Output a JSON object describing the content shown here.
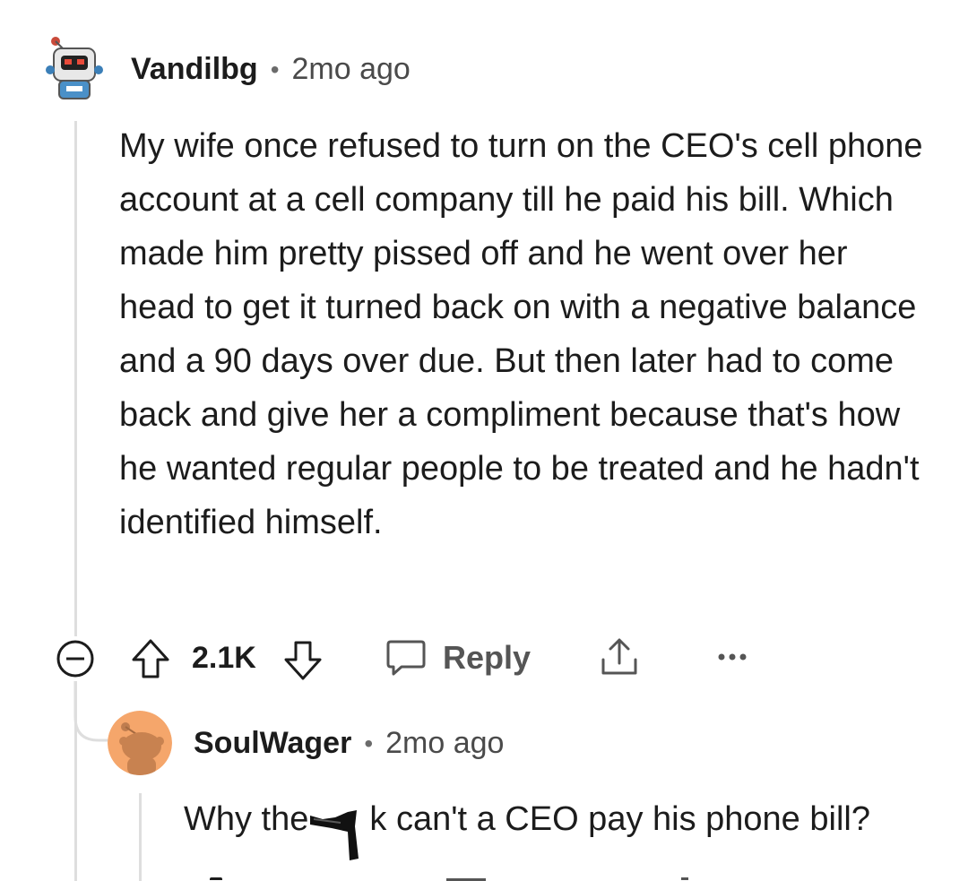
{
  "comment": {
    "author": "Vandilbg",
    "time": "2mo ago",
    "separator": "•",
    "body": "My wife once refused to turn on the CEO's cell phone account at a cell company till he paid his bill. Which made him pretty pissed off and he went over her head to get it turned back on with a negative balance and a 90 days over due. But then later had to come back and give her a compliment because that's how he wanted regular people to be treated and he hadn't identified himself.",
    "vote_count": "2.1K",
    "reply_label": "Reply"
  },
  "reply": {
    "author": "SoulWager",
    "time": "2mo ago",
    "separator": "•",
    "body_before": "Why the",
    "body_after": "k can't a CEO pay his phone bill?"
  },
  "icons": {
    "collapse": "collapse-minus-icon",
    "upvote": "arrow-up-icon",
    "downvote": "arrow-down-icon",
    "reply": "speech-bubble-icon",
    "share": "share-icon",
    "more": "more-dots-icon",
    "censor": "censor-sticker"
  },
  "colors": {
    "text": "#1c1c1c",
    "muted": "#4a4a4a",
    "thread_line": "#dedede",
    "snoo_orange": "#f5a66b"
  }
}
